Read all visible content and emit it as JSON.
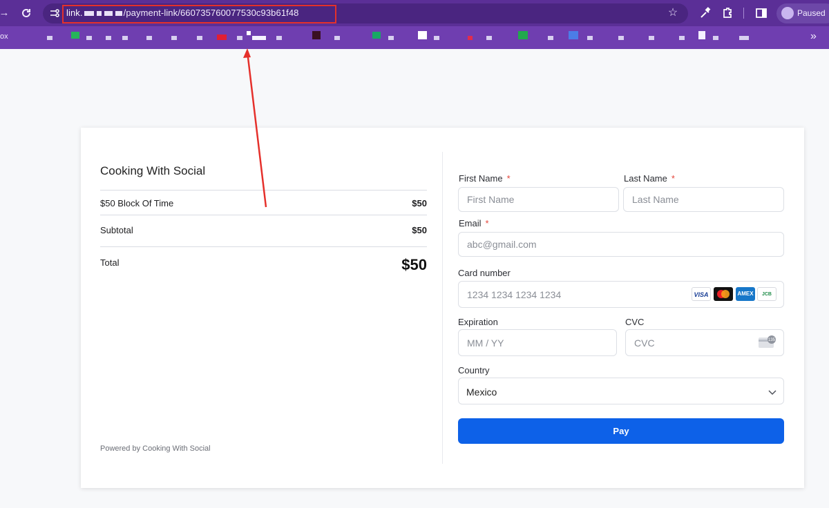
{
  "browser": {
    "url_host": "link.",
    "url_path": "/payment-link/660735760077530c93b61f48",
    "profile_status": "Paused",
    "bookmarks_left": "ox",
    "bookmarks_more": "»",
    "icons": [
      "back-icon",
      "reload-icon",
      "site-settings-icon",
      "bookmark-star-icon",
      "eyedropper-icon",
      "extensions-icon",
      "side-panel-icon",
      "profile-avatar-icon"
    ]
  },
  "summary": {
    "shop_name": "Cooking With Social",
    "items": [
      {
        "label": "$50 Block Of Time",
        "value": "$50"
      }
    ],
    "subtotal_label": "Subtotal",
    "subtotal_value": "$50",
    "total_label": "Total",
    "total_value": "$50",
    "powered_by": "Powered by Cooking With Social"
  },
  "form": {
    "first_name_label": "First Name",
    "first_name_placeholder": "First Name",
    "last_name_label": "Last Name",
    "last_name_placeholder": "Last Name",
    "required_mark": "*",
    "email_label": "Email",
    "email_placeholder": "abc@gmail.com",
    "card_number_label": "Card number",
    "card_number_placeholder": "1234 1234 1234 1234",
    "card_brands": [
      "VISA",
      "Mastercard",
      "AMEX",
      "JCB"
    ],
    "expiration_label": "Expiration",
    "expiration_placeholder": "MM / YY",
    "cvc_label": "CVC",
    "cvc_placeholder": "CVC",
    "cvc_hint": "135",
    "country_label": "Country",
    "country_value": "Mexico",
    "pay_label": "Pay"
  },
  "colors": {
    "browser_purple": "#5b2f97",
    "annotation_red": "#e5302b",
    "pay_blue": "#0d61e8"
  }
}
